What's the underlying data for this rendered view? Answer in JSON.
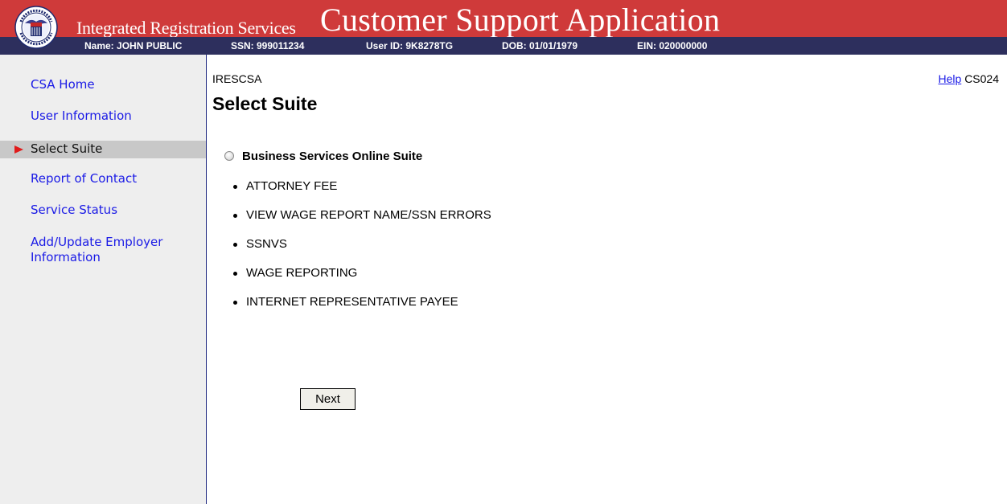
{
  "header": {
    "logo_text": "SOCIAL SECURITY ADMINISTRATION USA",
    "subtitle": "Integrated Registration Services",
    "title": "Customer Support Application",
    "colors": {
      "red": "#cf3a3a",
      "navy": "#2d2f5d"
    }
  },
  "user_bar": {
    "name": "Name: JOHN PUBLIC",
    "ssn": "SSN: 999011234",
    "user_id": "User ID: 9K8278TG",
    "dob": "DOB: 01/01/1979",
    "ein": "EIN: 020000000"
  },
  "sidebar": {
    "items": [
      {
        "label": "CSA Home"
      },
      {
        "label": "User Information"
      },
      {
        "label": "Select Suite",
        "active": true
      },
      {
        "label": "Report of Contact"
      },
      {
        "label": "Service Status"
      },
      {
        "label": "Add/Update Employer Information"
      }
    ]
  },
  "content": {
    "screen_code": "IRESCSA",
    "help_label": "Help",
    "page_id": "CS024",
    "title": "Select Suite",
    "suite": {
      "label": "Business Services Online Suite",
      "selected": false,
      "services": [
        "ATTORNEY FEE",
        "VIEW WAGE REPORT NAME/SSN ERRORS",
        "SSNVS",
        "WAGE REPORTING",
        "INTERNET REPRESENTATIVE PAYEE"
      ]
    },
    "next_label": "Next"
  }
}
